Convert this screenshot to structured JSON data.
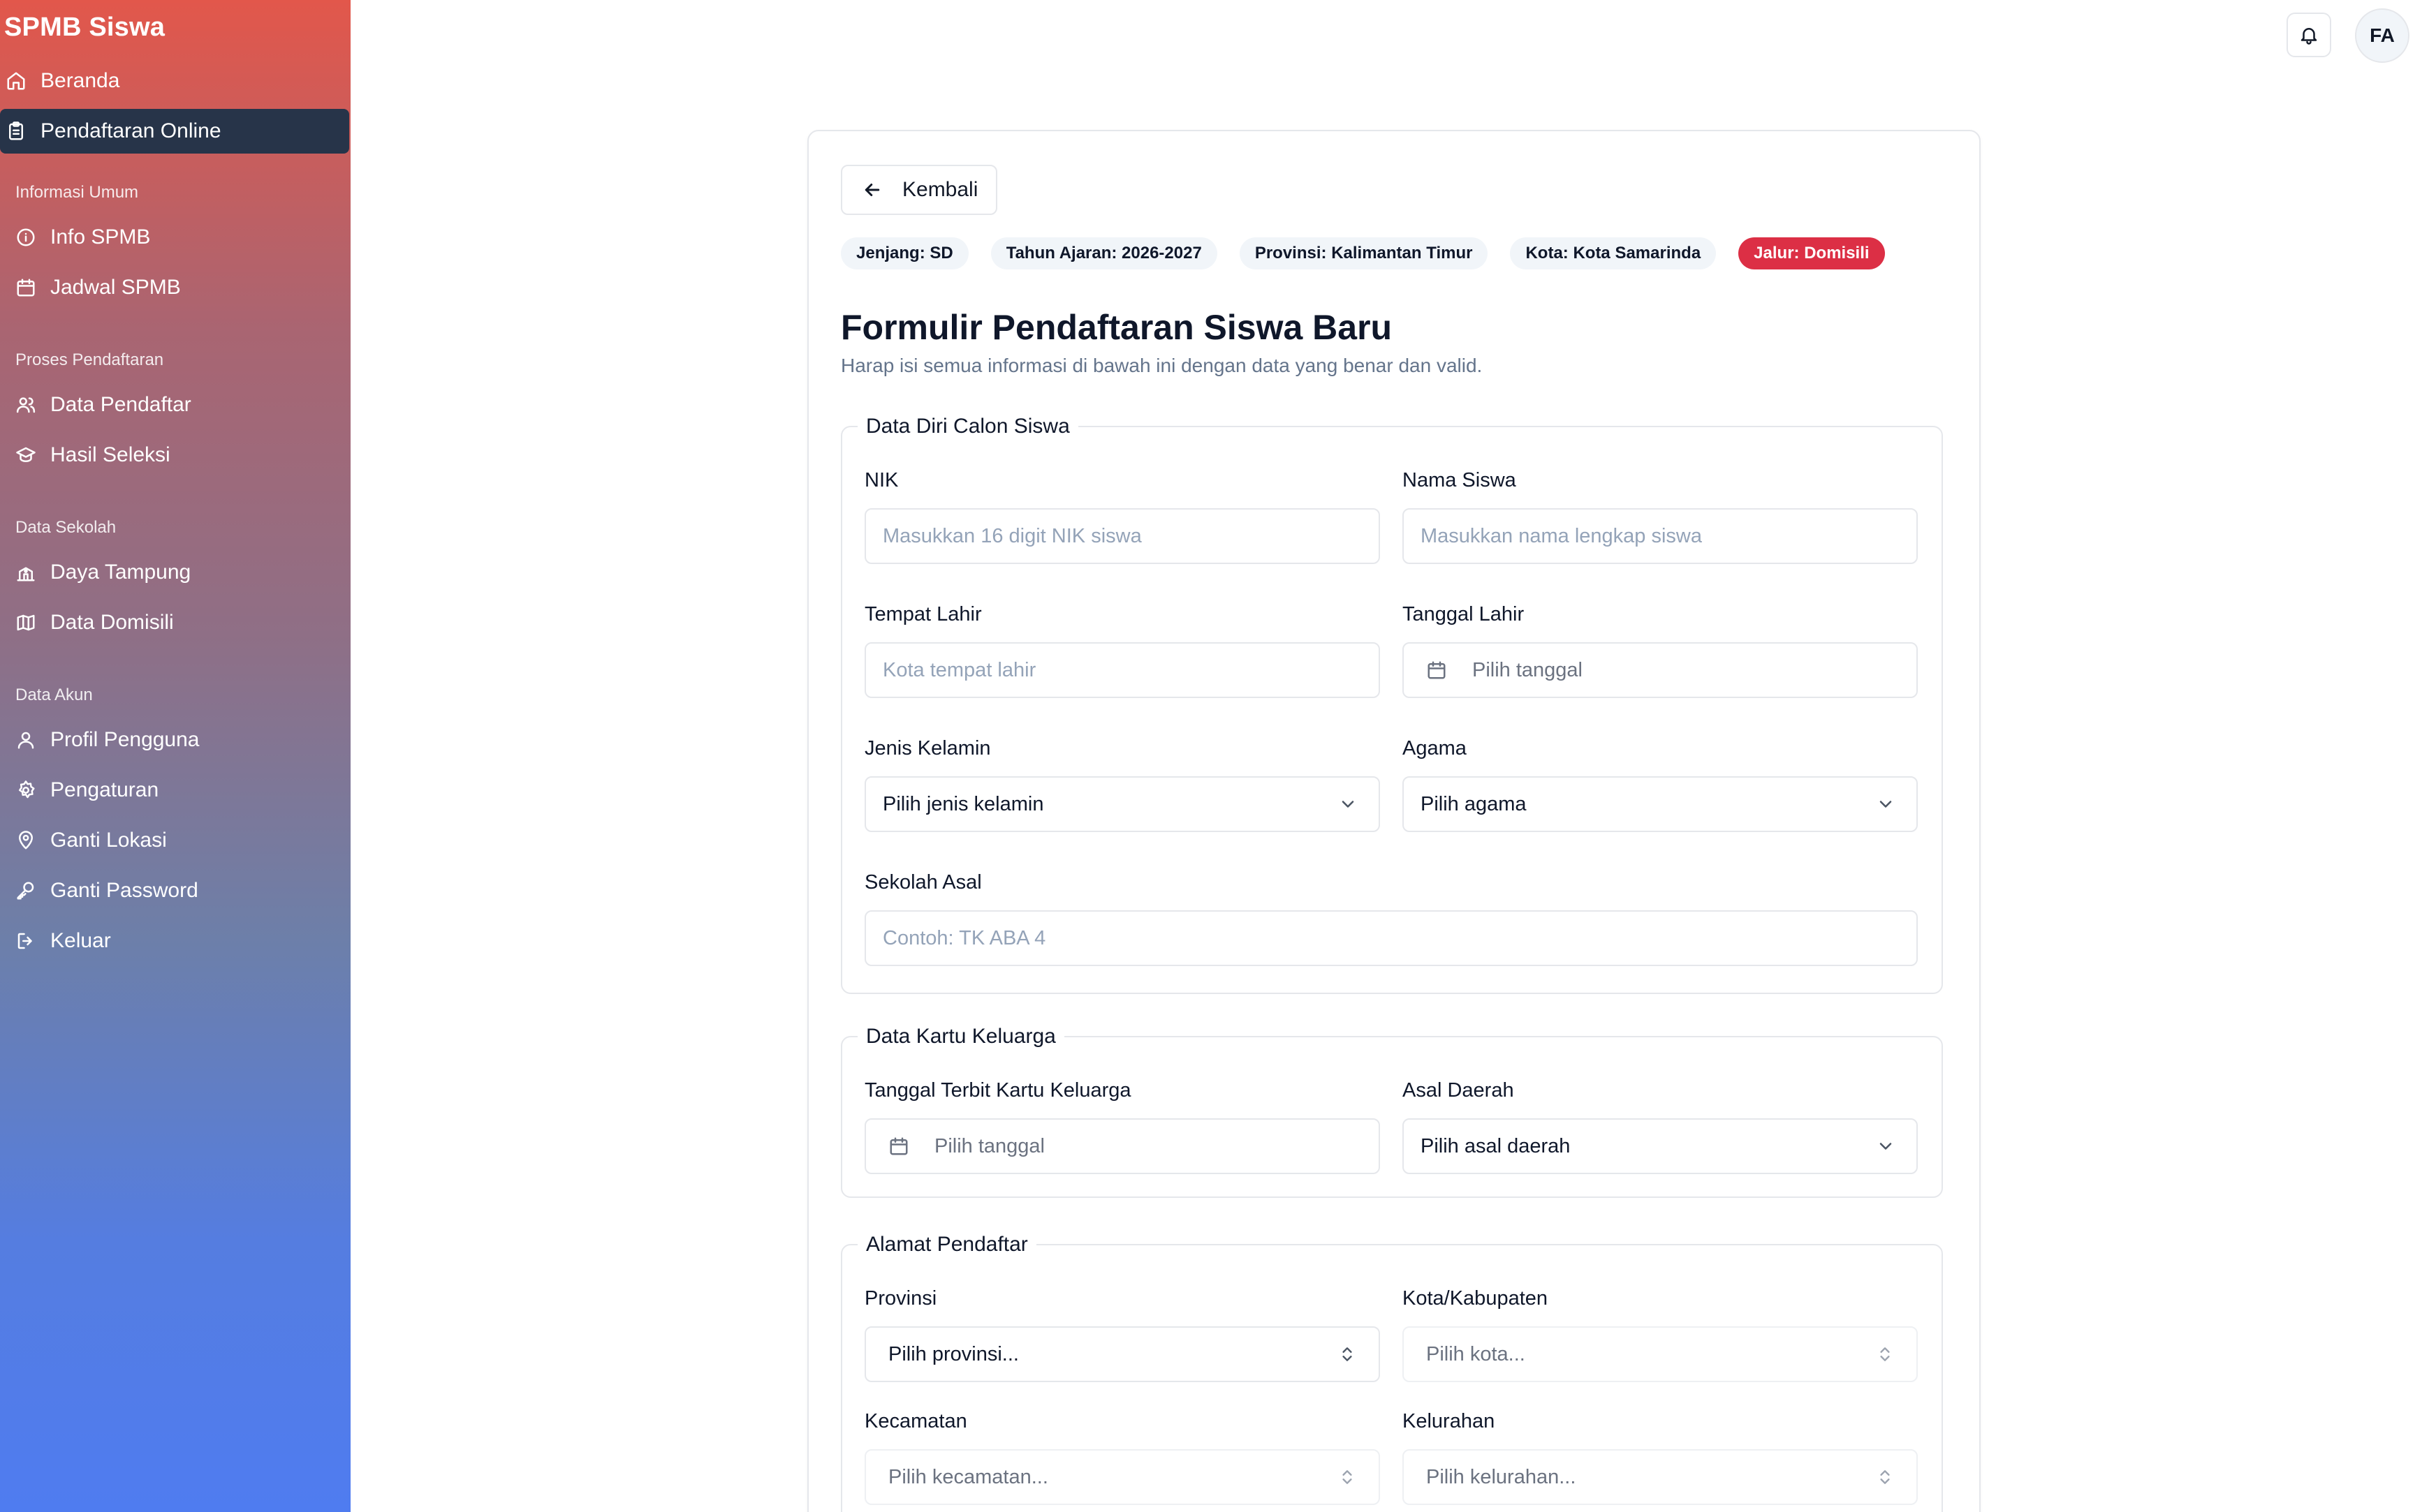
{
  "app": {
    "title": "SPMB Siswa"
  },
  "sidebar": {
    "top_items": [
      {
        "label": "Beranda",
        "icon": "home-icon"
      },
      {
        "label": "Pendaftaran Online",
        "icon": "clipboard-icon",
        "active": true
      }
    ],
    "sections": [
      {
        "label": "Informasi Umum",
        "items": [
          {
            "label": "Info SPMB",
            "icon": "info-icon"
          },
          {
            "label": "Jadwal SPMB",
            "icon": "calendar-icon"
          }
        ]
      },
      {
        "label": "Proses Pendaftaran",
        "items": [
          {
            "label": "Data Pendaftar",
            "icon": "users-icon"
          },
          {
            "label": "Hasil Seleksi",
            "icon": "graduation-cap-icon"
          }
        ]
      },
      {
        "label": "Data Sekolah",
        "items": [
          {
            "label": "Daya Tampung",
            "icon": "school-icon"
          },
          {
            "label": "Data Domisili",
            "icon": "map-icon"
          }
        ]
      },
      {
        "label": "Data Akun",
        "items": [
          {
            "label": "Profil Pengguna",
            "icon": "user-icon"
          },
          {
            "label": "Pengaturan",
            "icon": "gear-icon"
          },
          {
            "label": "Ganti Lokasi",
            "icon": "map-pin-icon"
          },
          {
            "label": "Ganti Password",
            "icon": "key-icon"
          },
          {
            "label": "Keluar",
            "icon": "logout-icon"
          }
        ]
      }
    ]
  },
  "header": {
    "avatar_initials": "FA",
    "bell_icon": "bell-icon"
  },
  "page": {
    "back_label": "Kembali",
    "chips": [
      "Jenjang: SD",
      "Tahun Ajaran: 2026-2027",
      "Provinsi: Kalimantan Timur",
      "Kota: Kota Samarinda",
      "Jalur: Domisili"
    ],
    "title": "Formulir Pendaftaran Siswa Baru",
    "subtitle": "Harap isi semua informasi di bawah ini dengan data yang benar dan valid."
  },
  "colors": {
    "accent_red": "#dc2f45",
    "active_nav": "#273449",
    "sidebar_top": "#e2574b",
    "sidebar_bottom": "#4f7cf0"
  },
  "form": {
    "data_diri": {
      "legend": "Data Diri Calon Siswa",
      "nik_label": "NIK",
      "nik_placeholder": "Masukkan 16 digit NIK siswa",
      "nama_label": "Nama Siswa",
      "nama_placeholder": "Masukkan nama lengkap siswa",
      "tempat_label": "Tempat Lahir",
      "tempat_placeholder": "Kota tempat lahir",
      "tanggal_label": "Tanggal Lahir",
      "tanggal_placeholder": "Pilih tanggal",
      "jk_label": "Jenis Kelamin",
      "jk_value": "Pilih jenis kelamin",
      "agama_label": "Agama",
      "agama_value": "Pilih agama",
      "sekolah_label": "Sekolah Asal",
      "sekolah_placeholder": "Contoh: TK ABA 4"
    },
    "kk": {
      "legend": "Data Kartu Keluarga",
      "tgl_label": "Tanggal Terbit Kartu Keluarga",
      "tgl_placeholder": "Pilih tanggal",
      "asal_label": "Asal Daerah",
      "asal_value": "Pilih asal daerah"
    },
    "alamat": {
      "legend": "Alamat Pendaftar",
      "provinsi_label": "Provinsi",
      "provinsi_value": "Pilih provinsi...",
      "kota_label": "Kota/Kabupaten",
      "kota_value": "Pilih kota...",
      "kecamatan_label": "Kecamatan",
      "kecamatan_value": "Pilih kecamatan...",
      "kelurahan_label": "Kelurahan",
      "kelurahan_value": "Pilih kelurahan..."
    }
  }
}
